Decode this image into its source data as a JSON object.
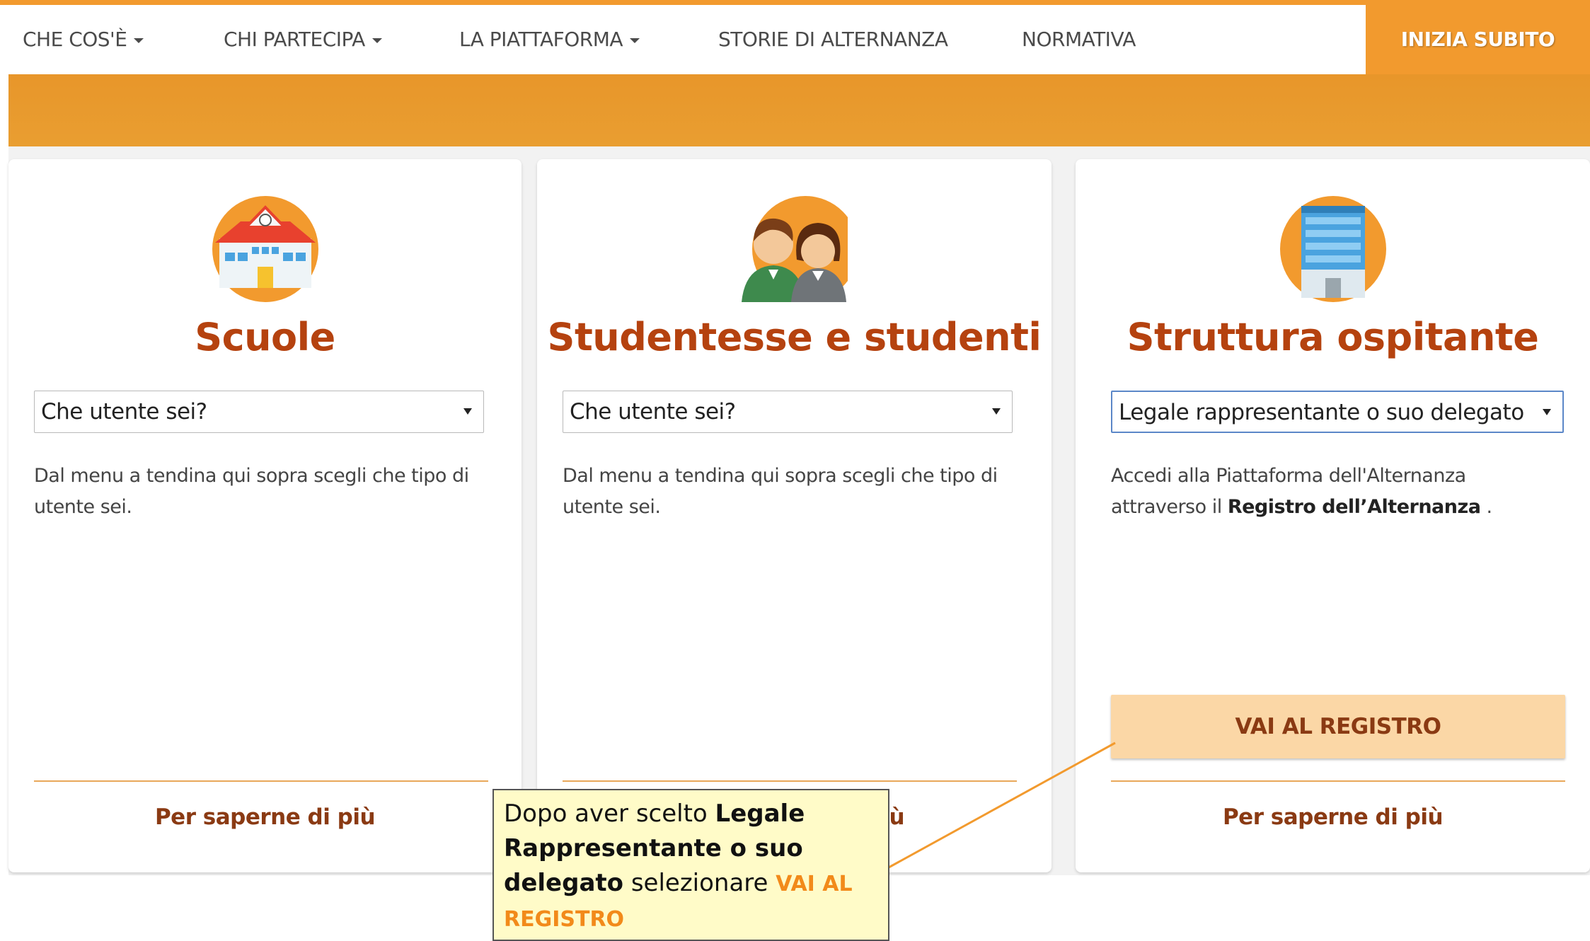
{
  "nav": {
    "items": [
      {
        "label": "CHE COS'È",
        "dropdown": true
      },
      {
        "label": "CHI PARTECIPA",
        "dropdown": true
      },
      {
        "label": "LA PIATTAFORMA",
        "dropdown": true
      },
      {
        "label": "STORIE DI ALTERNANZA",
        "dropdown": false
      },
      {
        "label": "NORMATIVA",
        "dropdown": false
      }
    ],
    "cta_label": "INIZIA SUBITO"
  },
  "cards": [
    {
      "title": "Scuole",
      "icon": "school-building-icon",
      "select_value": "Che utente sei?",
      "description": "Dal menu a tendina qui sopra scegli che tipo di utente sei.",
      "more_link": "Per saperne di più"
    },
    {
      "title": "Studentesse e studenti",
      "icon": "students-icon",
      "select_value": "Che utente sei?",
      "description": "Dal menu a tendina qui sopra scegli che tipo di utente sei.",
      "more_link": "Per saperne di più"
    },
    {
      "title": "Struttura ospitante",
      "icon": "office-building-icon",
      "select_value": "Legale rappresentante o suo delegato",
      "description_prefix": "Accedi alla Piattaforma dell'Alternanza attraverso il ",
      "description_bold": "Registro dell’Alternanza",
      "description_suffix": " .",
      "button_label": "VAI AL REGISTRO",
      "more_link": "Per saperne di più"
    }
  ],
  "callout": {
    "text_1": "Dopo aver scelto ",
    "bold": "Legale Rappresentante o suo delegato",
    "text_2": " selezionare ",
    "highlight": "VAI AL REGISTRO"
  },
  "colors": {
    "accent": "#f29a2e",
    "banner": "#e8962a",
    "title": "#b5420f",
    "link": "#8a3a13",
    "button_bg": "#fbd7a6",
    "callout_bg": "#fffbc8"
  }
}
